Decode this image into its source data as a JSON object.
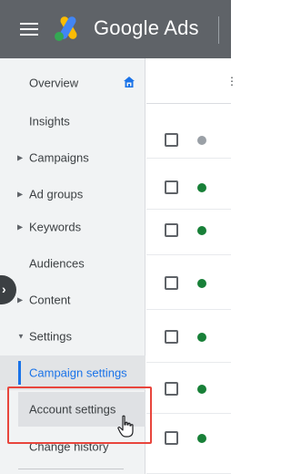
{
  "header": {
    "brand": "Google Ads"
  },
  "sidebar": {
    "items": [
      {
        "label": "Overview"
      },
      {
        "label": "Insights"
      },
      {
        "label": "Campaigns"
      },
      {
        "label": "Ad groups"
      },
      {
        "label": "Keywords"
      },
      {
        "label": "Audiences"
      },
      {
        "label": "Content"
      },
      {
        "label": "Settings"
      },
      {
        "label": "Campaign settings"
      },
      {
        "label": "Account settings"
      },
      {
        "label": "Change history"
      }
    ]
  },
  "table": {
    "header_status_color": "#9aa0a6",
    "rows": [
      {
        "status": "enabled",
        "status_color": "#188038"
      },
      {
        "status": "enabled",
        "status_color": "#188038"
      },
      {
        "status": "enabled",
        "status_color": "#188038"
      },
      {
        "status": "enabled",
        "status_color": "#188038"
      },
      {
        "status": "enabled",
        "status_color": "#188038"
      },
      {
        "status": "enabled",
        "status_color": "#188038"
      },
      {
        "status": "enabled",
        "status_color": "#188038"
      }
    ]
  },
  "colors": {
    "header_bg": "#5f6368",
    "sidebar_bg": "#f1f3f4",
    "accent": "#1a73e8",
    "highlight": "#e8453c"
  },
  "icons": {
    "menu": "hamburger-menu-icon",
    "logo": "google-ads-logo",
    "home": "home-icon",
    "collapse": "chevron-right-icon",
    "cursor": "hand-pointer-icon"
  }
}
